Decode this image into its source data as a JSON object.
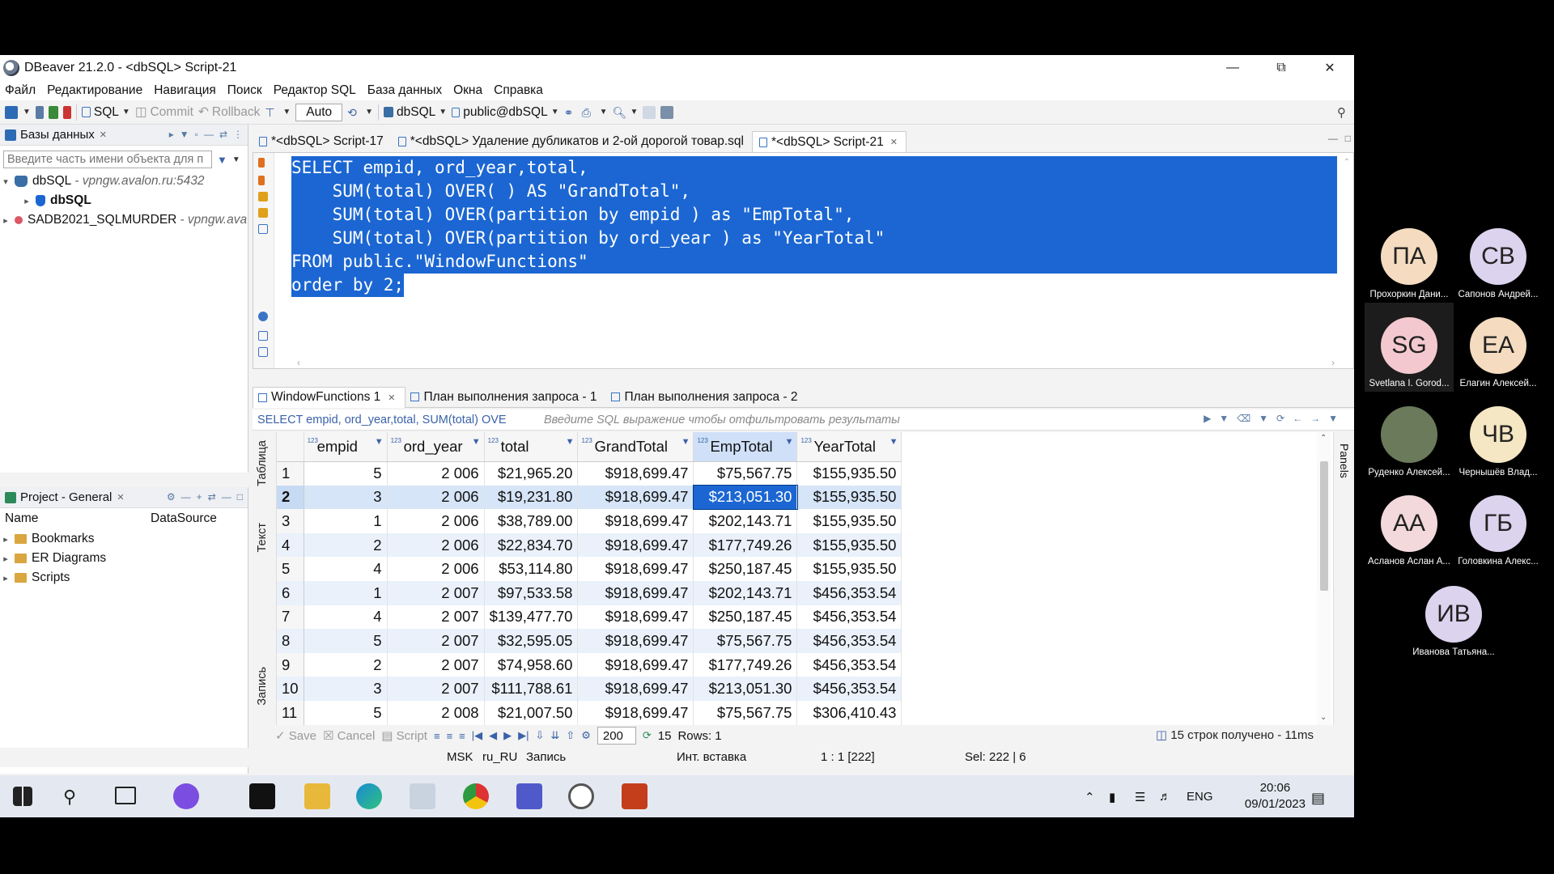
{
  "window": {
    "title": "DBeaver 21.2.0 - <dbSQL> Script-21"
  },
  "menu": [
    "Файл",
    "Редактирование",
    "Навигация",
    "Поиск",
    "Редактор SQL",
    "База данных",
    "Окна",
    "Справка"
  ],
  "toolbar": {
    "sql": "SQL",
    "commit": "Commit",
    "rollback": "Rollback",
    "auto": "Auto",
    "connection": "dbSQL",
    "schema": "public@dbSQL"
  },
  "db_panel": {
    "title": "Базы данных",
    "filter_placeholder": "Введите часть имени объекта для п",
    "tree": [
      {
        "name": "dbSQL",
        "sub": "- vpngw.avalon.ru:5432"
      },
      {
        "name": "dbSQL",
        "sub": ""
      },
      {
        "name": "SADB2021_SQLMURDER",
        "sub": "- vpngw.ava"
      }
    ]
  },
  "project_panel": {
    "title": "Project - General",
    "col_name": "Name",
    "col_source": "DataSource",
    "items": [
      "Bookmarks",
      "ER Diagrams",
      "Scripts"
    ]
  },
  "editor_tabs": [
    "*<dbSQL> Script-17",
    "*<dbSQL> Удаление дубликатов и 2-ой дорогой товар.sql",
    "*<dbSQL> Script-21"
  ],
  "sql_lines": [
    "SELECT empid, ord_year,total,",
    "    SUM(total) OVER( ) AS \"GrandTotal\",",
    "    SUM(total) OVER(partition by empid ) as \"EmpTotal\",",
    "    SUM(total) OVER(partition by ord_year ) as \"YearTotal\"",
    "FROM public.\"WindowFunctions\"",
    "order by 2;"
  ],
  "result_tabs": [
    "WindowFunctions 1",
    "План выполнения запроса - 1",
    "План выполнения запроса - 2"
  ],
  "result_filter": {
    "query": "SELECT empid, ord_year,total, SUM(total) OVE",
    "placeholder": "Введите SQL выражение чтобы отфильтровать результаты"
  },
  "side_tabs": {
    "table": "Таблица",
    "text": "Текст",
    "record": "Запись"
  },
  "panels_label": "Panels",
  "grid": {
    "columns": [
      "empid",
      "ord_year",
      "total",
      "GrandTotal",
      "EmpTotal",
      "YearTotal"
    ],
    "rows": [
      [
        "1",
        "5",
        "2 006",
        "$21,965.20",
        "$918,699.47",
        "$75,567.75",
        "$155,935.50"
      ],
      [
        "2",
        "3",
        "2 006",
        "$19,231.80",
        "$918,699.47",
        "$213,051.30",
        "$155,935.50"
      ],
      [
        "3",
        "1",
        "2 006",
        "$38,789.00",
        "$918,699.47",
        "$202,143.71",
        "$155,935.50"
      ],
      [
        "4",
        "2",
        "2 006",
        "$22,834.70",
        "$918,699.47",
        "$177,749.26",
        "$155,935.50"
      ],
      [
        "5",
        "4",
        "2 006",
        "$53,114.80",
        "$918,699.47",
        "$250,187.45",
        "$155,935.50"
      ],
      [
        "6",
        "1",
        "2 007",
        "$97,533.58",
        "$918,699.47",
        "$202,143.71",
        "$456,353.54"
      ],
      [
        "7",
        "4",
        "2 007",
        "$139,477.70",
        "$918,699.47",
        "$250,187.45",
        "$456,353.54"
      ],
      [
        "8",
        "5",
        "2 007",
        "$32,595.05",
        "$918,699.47",
        "$75,567.75",
        "$456,353.54"
      ],
      [
        "9",
        "2",
        "2 007",
        "$74,958.60",
        "$918,699.47",
        "$177,749.26",
        "$456,353.54"
      ],
      [
        "10",
        "3",
        "2 007",
        "$111,788.61",
        "$918,699.47",
        "$213,051.30",
        "$456,353.54"
      ],
      [
        "11",
        "5",
        "2 008",
        "$21,007.50",
        "$918,699.47",
        "$75,567.75",
        "$306,410.43"
      ]
    ]
  },
  "result_bottom": {
    "save": "Save",
    "cancel": "Cancel",
    "script": "Script",
    "fetch_size": "200",
    "count": "15",
    "rows": "Rows: 1",
    "status": "15 строк получено - 11ms"
  },
  "statusbar": {
    "tz": "MSK",
    "locale": "ru_RU",
    "mode": "Запись",
    "insert": "Инт. вставка",
    "pos": "1 : 1 [222]",
    "sel": "Sel: 222 | 6"
  },
  "taskbar": {
    "lang": "ENG",
    "time": "20:06",
    "date": "09/01/2023"
  },
  "participants": [
    {
      "initials": "ПА",
      "name": "Прохоркин Дани...",
      "color": "#f5dcc0"
    },
    {
      "initials": "СВ",
      "name": "Сапонов Андрей...",
      "color": "#dcd3ee"
    },
    {
      "initials": "SG",
      "name": "Svetlana I. Gorod...",
      "color": "#f3c9cf"
    },
    {
      "initials": "ЕА",
      "name": "Елагин Алексей...",
      "color": "#f5dcc0"
    },
    {
      "initials": "",
      "name": "Руденко Алексей...",
      "color": "#6a7a5a"
    },
    {
      "initials": "ЧВ",
      "name": "Чернышёв Влад...",
      "color": "#f5e6c4"
    },
    {
      "initials": "АА",
      "name": "Асланов Аслан А...",
      "color": "#f3d9dc"
    },
    {
      "initials": "ГБ",
      "name": "Головкина Алекс...",
      "color": "#dcd3ee"
    },
    {
      "initials": "ИВ",
      "name": "Иванова Татьяна...",
      "color": "#dcd3ee"
    }
  ]
}
